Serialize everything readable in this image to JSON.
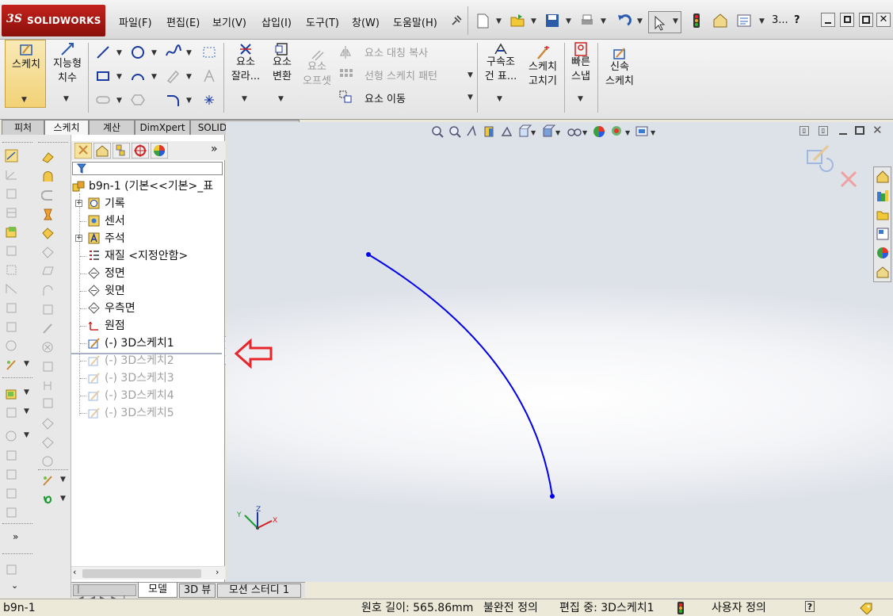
{
  "app": {
    "logo_ds": "3S",
    "logo_name": "SOLIDWORKS"
  },
  "menu": [
    "파일(F)",
    "편집(E)",
    "보기(V)",
    "삽입(I)",
    "도구(T)",
    "창(W)",
    "도움말(H)"
  ],
  "titlebar": {
    "doc_label": "3...",
    "help": "?"
  },
  "ribbon": {
    "sketch": "스케치",
    "smart_dim_1": "지능형",
    "smart_dim_2": "치수",
    "trim_1": "요소",
    "trim_2": "잘라...",
    "convert_1": "요소",
    "convert_2": "변환",
    "offset_1": "요소",
    "offset_2": "오프셋",
    "mirror": "요소 대칭 복사",
    "pattern": "선형 스케치 패턴",
    "move": "요소 이동",
    "relations_1": "구속조",
    "relations_2": "건 표...",
    "repair_1": "스케치",
    "repair_2": "고치기",
    "snap_1": "빠른",
    "snap_2": "스냅",
    "rapid_1": "신속",
    "rapid_2": "스케치"
  },
  "tabs": [
    "피처",
    "스케치",
    "계산",
    "DimXpert",
    "SOLIDWORKS 애드인"
  ],
  "tree": {
    "root": "b9n-1  (기본<<기본>_표",
    "items": [
      {
        "label": "기록",
        "expand": true,
        "dim": false
      },
      {
        "label": "센서",
        "expand": false,
        "dim": false
      },
      {
        "label": "주석",
        "expand": true,
        "dim": false
      },
      {
        "label": "재질 <지정안함>",
        "expand": false,
        "dim": false
      },
      {
        "label": "정면",
        "expand": false,
        "dim": false
      },
      {
        "label": "윗면",
        "expand": false,
        "dim": false
      },
      {
        "label": "우측면",
        "expand": false,
        "dim": false
      },
      {
        "label": "원점",
        "expand": false,
        "dim": false
      },
      {
        "label": "(-) 3D스케치1",
        "expand": false,
        "dim": false
      },
      {
        "label": "(-) 3D스케치2",
        "expand": false,
        "dim": true
      },
      {
        "label": "(-) 3D스케치3",
        "expand": false,
        "dim": true
      },
      {
        "label": "(-) 3D스케치4",
        "expand": false,
        "dim": true
      },
      {
        "label": "(-) 3D스케치5",
        "expand": false,
        "dim": true
      }
    ]
  },
  "bottom_tabs": [
    "모델",
    "3D 뷰",
    "모션 스터디 1"
  ],
  "status": {
    "doc": "b9n-1",
    "arc_length": "원호 길이: 565.86mm",
    "definition": "불완전 정의",
    "editing": "편집 중: 3D스케치1",
    "units": "사용자 정의",
    "help": "?"
  },
  "triad": {
    "x": "X",
    "y": "Y",
    "z": "Z"
  },
  "colors": {
    "curve": "#0000ee",
    "arrow": "#e8252a",
    "brand": "#c4221c"
  }
}
